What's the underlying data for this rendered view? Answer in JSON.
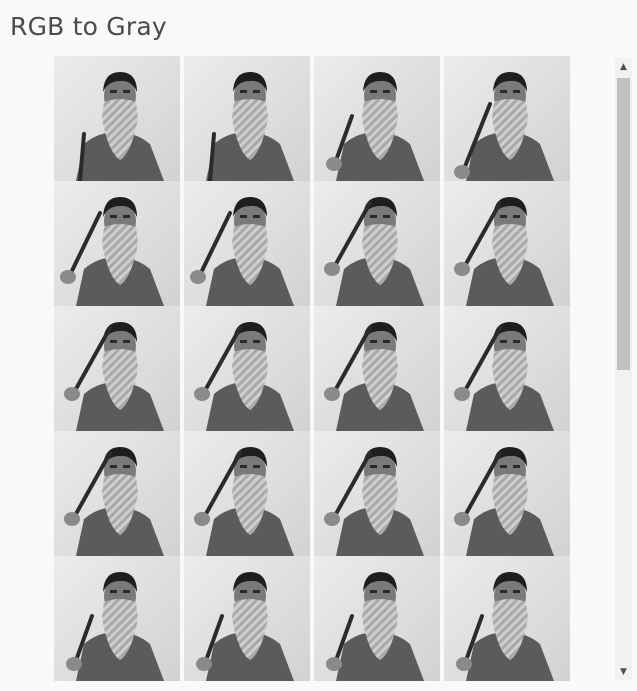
{
  "page": {
    "title": "RGB to Gray"
  },
  "gallery": {
    "rows": 5,
    "columns": 4,
    "frames": [
      {
        "row": 1,
        "col": 1,
        "tool": "left-low"
      },
      {
        "row": 1,
        "col": 2,
        "tool": "left-low"
      },
      {
        "row": 1,
        "col": 3,
        "tool": "left-mid"
      },
      {
        "row": 1,
        "col": 4,
        "tool": "right-raised"
      },
      {
        "row": 2,
        "col": 1,
        "tool": "left-raised"
      },
      {
        "row": 2,
        "col": 2,
        "tool": "left-raised"
      },
      {
        "row": 2,
        "col": 3,
        "tool": "left-high"
      },
      {
        "row": 2,
        "col": 4,
        "tool": "left-high"
      },
      {
        "row": 3,
        "col": 1,
        "tool": "left-high"
      },
      {
        "row": 3,
        "col": 2,
        "tool": "left-high"
      },
      {
        "row": 3,
        "col": 3,
        "tool": "left-high"
      },
      {
        "row": 3,
        "col": 4,
        "tool": "left-high"
      },
      {
        "row": 4,
        "col": 1,
        "tool": "left-high"
      },
      {
        "row": 4,
        "col": 2,
        "tool": "left-high"
      },
      {
        "row": 4,
        "col": 3,
        "tool": "left-high"
      },
      {
        "row": 4,
        "col": 4,
        "tool": "left-high"
      },
      {
        "row": 5,
        "col": 1,
        "tool": "left-mid"
      },
      {
        "row": 5,
        "col": 2,
        "tool": "left-mid"
      },
      {
        "row": 5,
        "col": 3,
        "tool": "left-mid"
      },
      {
        "row": 5,
        "col": 4,
        "tool": "left-mid"
      }
    ]
  },
  "scrollbar": {
    "up_icon": "triangle-up-icon",
    "down_icon": "triangle-down-icon",
    "up_glyph": "▲",
    "down_glyph": "▼",
    "scroll_fraction": 0.0
  },
  "colors": {
    "background": "#f8f9fb",
    "title_text": "#4a4a4a",
    "scroll_track": "#f1f1f1",
    "scroll_thumb": "#c1c1c1"
  }
}
